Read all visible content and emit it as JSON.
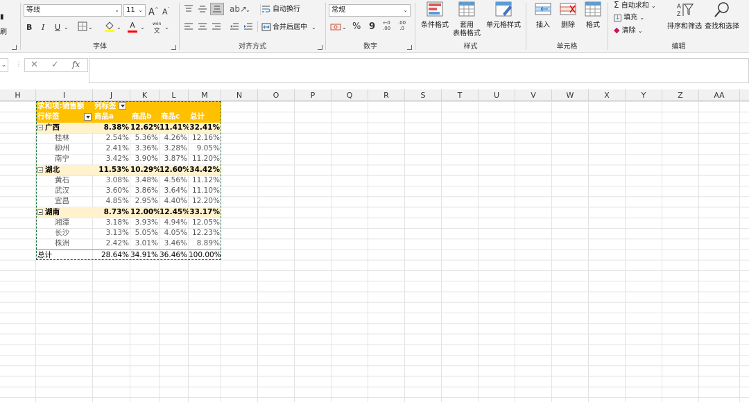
{
  "ribbon": {
    "clipboard": {
      "partial_label": "刷"
    },
    "font": {
      "label": "字体",
      "family": "等线",
      "size": "11",
      "grow": "A",
      "shrink": "A",
      "bold": "B",
      "italic": "I",
      "underline": "U",
      "font_color": "A",
      "wen": "文"
    },
    "alignment": {
      "label": "对齐方式",
      "wrap_text": "自动换行",
      "merge_center": "合并后居中"
    },
    "number": {
      "label": "数字",
      "format": "常规",
      "percent": "%",
      "comma": "9",
      "inc_dec": ".00",
      "dec_dec": ".0"
    },
    "styles": {
      "label": "样式",
      "conditional": "条件格式",
      "table_format_1": "套用",
      "table_format_2": "表格格式",
      "cell_styles": "单元格样式"
    },
    "cells": {
      "label": "单元格",
      "insert": "插入",
      "delete": "删除",
      "format": "格式"
    },
    "editing": {
      "label": "编辑",
      "autosum": "自动求和",
      "fill": "填充",
      "clear": "清除",
      "sort_filter": "排序和筛选",
      "find_select": "查找和选择"
    }
  },
  "formula_bar": {
    "fx": "fx",
    "cancel": "✕",
    "enter": "✓",
    "value": ""
  },
  "columns": [
    "H",
    "I",
    "J",
    "K",
    "L",
    "M",
    "N",
    "O",
    "P",
    "Q",
    "R",
    "S",
    "T",
    "U",
    "V",
    "W",
    "X",
    "Y",
    "Z",
    "AA"
  ],
  "pivot": {
    "header1": {
      "title": "求和项:销售额",
      "col_labels": "列标签"
    },
    "header2": {
      "row_labels": "行标签",
      "cols": [
        "商品a",
        "商品b",
        "商品c",
        "总计"
      ]
    },
    "groups": [
      {
        "name": "广西",
        "values": [
          "8.38%",
          "12.62%",
          "11.41%",
          "32.41%"
        ],
        "items": [
          {
            "name": "桂林",
            "values": [
              "2.54%",
              "5.36%",
              "4.26%",
              "12.16%"
            ]
          },
          {
            "name": "柳州",
            "values": [
              "2.41%",
              "3.36%",
              "3.28%",
              "9.05%"
            ]
          },
          {
            "name": "南宁",
            "values": [
              "3.42%",
              "3.90%",
              "3.87%",
              "11.20%"
            ]
          }
        ]
      },
      {
        "name": "湖北",
        "values": [
          "11.53%",
          "10.29%",
          "12.60%",
          "34.42%"
        ],
        "items": [
          {
            "name": "黄石",
            "values": [
              "3.08%",
              "3.48%",
              "4.56%",
              "11.12%"
            ]
          },
          {
            "name": "武汉",
            "values": [
              "3.60%",
              "3.86%",
              "3.64%",
              "11.10%"
            ]
          },
          {
            "name": "宜昌",
            "values": [
              "4.85%",
              "2.95%",
              "4.40%",
              "12.20%"
            ]
          }
        ]
      },
      {
        "name": "湖南",
        "values": [
          "8.73%",
          "12.00%",
          "12.45%",
          "33.17%"
        ],
        "items": [
          {
            "name": "湘潭",
            "values": [
              "3.18%",
              "3.93%",
              "4.94%",
              "12.05%"
            ]
          },
          {
            "name": "长沙",
            "values": [
              "3.13%",
              "5.05%",
              "4.05%",
              "12.23%"
            ]
          },
          {
            "name": "株洲",
            "values": [
              "2.42%",
              "3.01%",
              "3.46%",
              "8.89%"
            ]
          }
        ]
      }
    ],
    "total": {
      "label": "总计",
      "values": [
        "28.64%",
        "34.91%",
        "36.46%",
        "100.00%"
      ]
    }
  },
  "colors": {
    "pivot_header": "#ffc000",
    "group_row": "#fff2cc",
    "marching_ants": "#1e7145"
  }
}
